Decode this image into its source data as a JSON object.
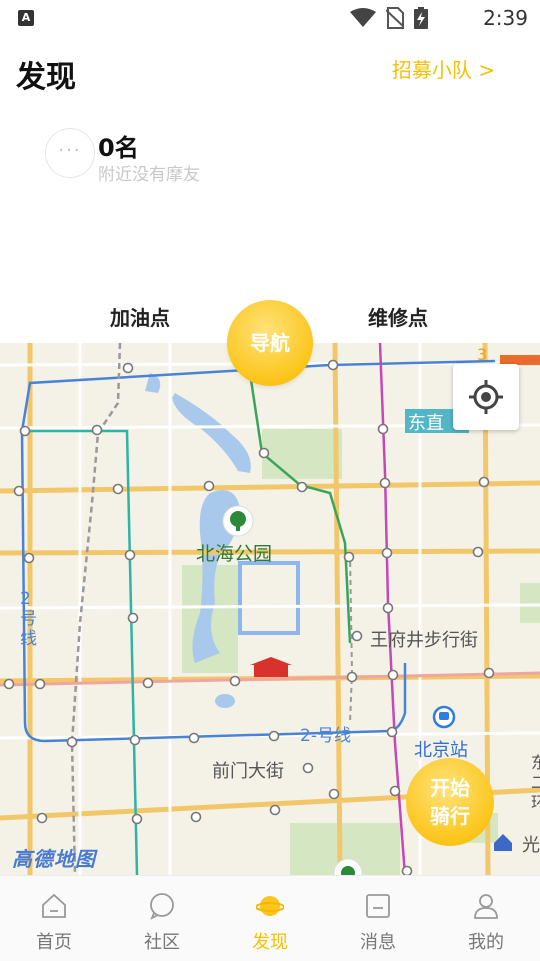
{
  "status_bar": {
    "app_badge": "A",
    "time": "2:39"
  },
  "header": {
    "title": "发现",
    "recruit_link": "招募小队 >"
  },
  "ranking": {
    "avatar_text": "···",
    "rank": "0名",
    "subtitle": "附近没有摩友"
  },
  "tabs": {
    "gas": "加油点",
    "navigate": "导航",
    "repair": "维修点"
  },
  "map": {
    "labels": {
      "beihai": "北海公园",
      "wangfujing": "王府井步行街",
      "qianmen": "前门大街",
      "beijing_station": "北京站",
      "dongzhi": "东直",
      "line2_vertical": "2\n号\n线",
      "line2_horizontal": "2-号线",
      "guang": "光",
      "edge_chars": "东\n二\n环",
      "line3": "3"
    },
    "start_button_line1": "开始",
    "start_button_line2": "骑行",
    "logo": "高德地图"
  },
  "tabbar": {
    "items": [
      {
        "label": "首页",
        "icon": "home-icon"
      },
      {
        "label": "社区",
        "icon": "chat-bubble-icon"
      },
      {
        "label": "发现",
        "icon": "planet-icon",
        "active": true
      },
      {
        "label": "消息",
        "icon": "message-icon"
      },
      {
        "label": "我的",
        "icon": "user-icon"
      }
    ]
  },
  "colors": {
    "accent": "#f5c200",
    "button_yellow": "#fbc51a"
  }
}
